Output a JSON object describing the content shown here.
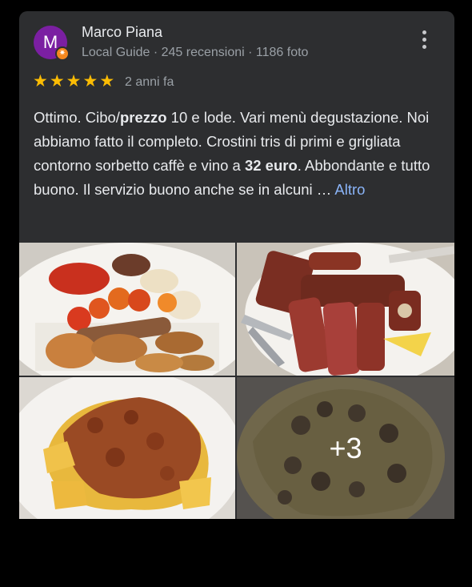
{
  "review": {
    "avatar_letter": "M",
    "author": "Marco Piana",
    "meta": "Local Guide · 245 recensioni · 1186 foto",
    "rating": 5,
    "date": "2 anni fa",
    "text_part1": "Ottimo. Cibo/",
    "text_bold1": "prezzo",
    "text_part2": " 10 e lode. Vari menù degustazione. Noi abbiamo fatto il completo. Crostini tris di primi e grigliata contorno sorbetto caffè e vino a ",
    "text_bold2": "32 euro",
    "text_part3": ". Abbondante e tutto buono. Il servizio buono anche se in alcuni … ",
    "more_link": "Altro"
  },
  "photos": {
    "extra_count": "+3"
  },
  "colors": {
    "card_bg": "#2d2e30",
    "star": "#fbbc04",
    "link": "#8ab4f8",
    "avatar_bg": "#7b1fa2",
    "guide_badge": "#f4881f"
  },
  "icons": [
    "more-vert-icon",
    "star-icon",
    "local-guide-badge-icon"
  ]
}
